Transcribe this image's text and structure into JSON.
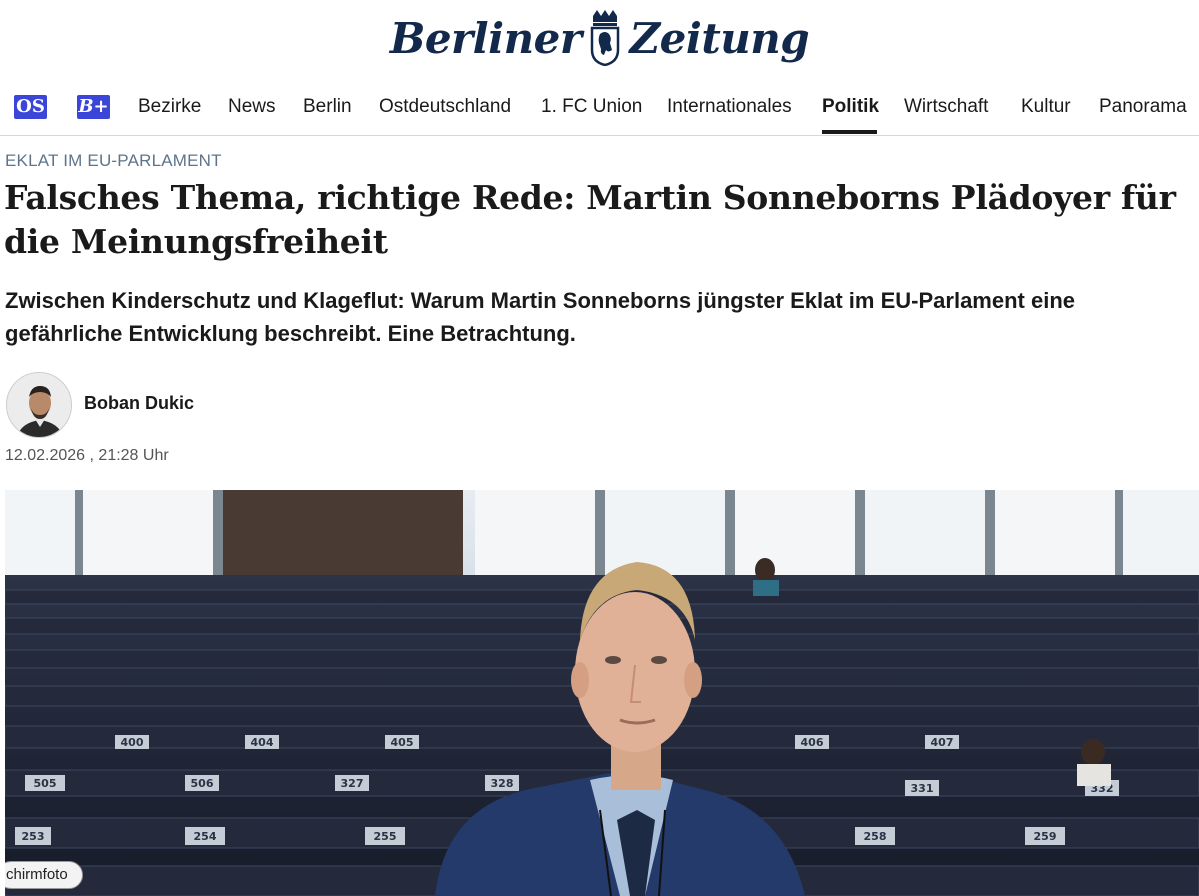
{
  "brand": {
    "name_left": "Berliner",
    "name_right": "Zeitung",
    "crest_icon": "bear-crest-icon",
    "color": "#13294b"
  },
  "nav": {
    "badges": [
      {
        "label": "OS",
        "color": "#3b45d8"
      },
      {
        "label": "B+",
        "color": "#3b45d8"
      }
    ],
    "items": [
      {
        "label": "Bezirke"
      },
      {
        "label": "News"
      },
      {
        "label": "Berlin"
      },
      {
        "label": "Ostdeutschland"
      },
      {
        "label": "1. FC Union"
      },
      {
        "label": "Internationales"
      },
      {
        "label": "Politik",
        "active": true
      },
      {
        "label": "Wirtschaft"
      },
      {
        "label": "Kultur"
      },
      {
        "label": "Panorama"
      }
    ]
  },
  "article": {
    "kicker": "EKLAT IM EU-PARLAMENT",
    "kicker_color": "#5e748a",
    "headline": "Falsches Thema, richtige Rede: Martin Sonneborns Plädoyer für die Meinungsfreiheit",
    "teaser": "Zwischen Kinderschutz und Klageflut: Warum Martin Sonneborns jüngster Eklat im EU-Parlament eine gefährliche Entwicklung beschreibt. Eine Betrachtung.",
    "author": "Boban Dukic",
    "dateline": "12.02.2026 , 21:28 Uhr",
    "image_caption": "chirmfoto",
    "seat_numbers": [
      "505",
      "506",
      "253",
      "254",
      "255",
      "327",
      "328",
      "400",
      "404",
      "405",
      "406",
      "407",
      "258",
      "259",
      "331",
      "332"
    ]
  }
}
